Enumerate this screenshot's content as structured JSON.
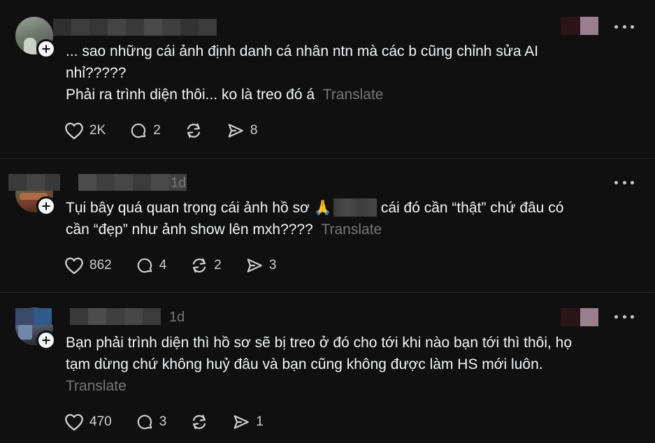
{
  "posts": [
    {
      "timestamp": "",
      "text_lines": [
        "... sao những cái ảnh định danh cá nhân ntn mà các b cũng chỉnh sửa AI",
        "nhỉ?????"
      ],
      "text_last": "Phải ra trình diện thôi... ko là treo đó á",
      "translate_label": "Translate",
      "likes": "2K",
      "replies": "2",
      "reposts": "",
      "shares": "8"
    },
    {
      "timestamp": "1d",
      "text_prefix": "Tụi bây quá quan trọng cái ảnh hồ sơ",
      "emoji": "🙏",
      "text_after_censor": "cái đó cần “thật” chứ đâu có",
      "text_last": "cần “đẹp” như ảnh show lên mxh????",
      "translate_label": "Translate",
      "likes": "862",
      "replies": "4",
      "reposts": "2",
      "shares": "3"
    },
    {
      "timestamp": "1d",
      "text_lines": [
        "Bạn phải trình diện thì hồ sơ sẽ bị treo ở đó cho tới khi nào bạn tới thì thôi, họ",
        "tạm dừng chứ không huỷ đâu và bạn cũng không được làm HS mới luôn."
      ],
      "translate_label": "Translate",
      "likes": "470",
      "replies": "3",
      "reposts": "",
      "shares": "1"
    }
  ],
  "icons": {
    "like": "heart-icon",
    "reply": "comment-bubble-icon",
    "repost": "repost-icon",
    "share": "send-icon",
    "more": "more-dots-icon",
    "follow": "plus-icon"
  },
  "colors": {
    "background": "#101010",
    "text": "#f3f5f7",
    "muted": "#777777",
    "divider": "#2a2a2a"
  }
}
